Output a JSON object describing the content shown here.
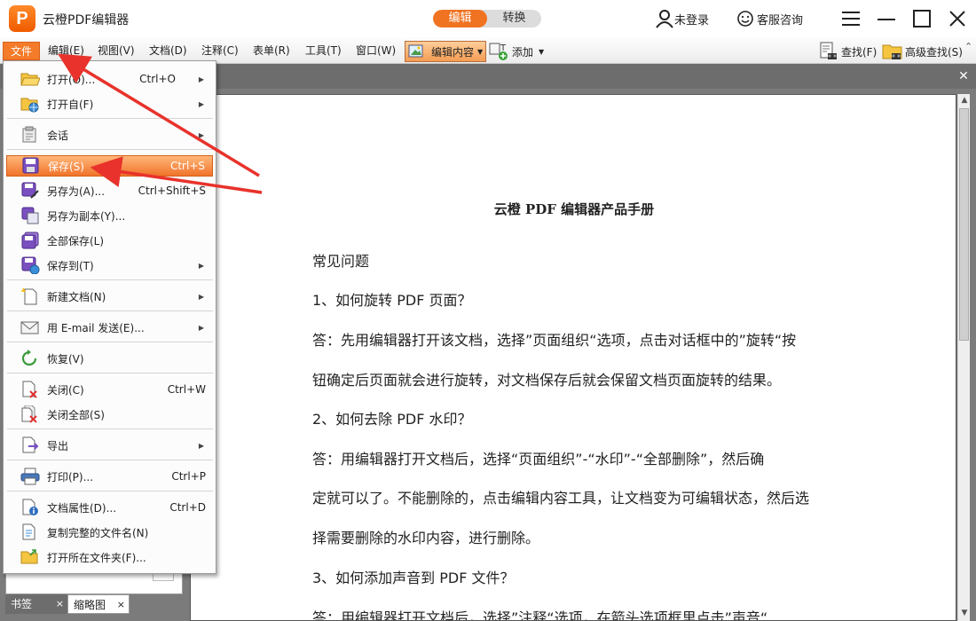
{
  "titlebar": {
    "logo_letter": "P",
    "app_title": "云橙PDF编辑器",
    "mode_edit": "编辑",
    "mode_convert": "转换",
    "login": "未登录",
    "support": "客服咨询"
  },
  "menubar": {
    "file": "文件",
    "edit": "编辑(E)",
    "view": "视图(V)",
    "document": "文档(D)",
    "comment": "注释(C)",
    "form": "表单(R)",
    "tools": "工具(T)",
    "window": "窗口(W)",
    "edit_content": "编辑内容",
    "add": "添加",
    "find": "查找(F)",
    "advanced_find": "高级查找(S)"
  },
  "file_menu": {
    "items": [
      {
        "label": "打开(O)...",
        "shortcut": "Ctrl+O"
      },
      {
        "label": "打开自(F)",
        "shortcut": ""
      },
      {
        "label": "会话",
        "shortcut": ""
      },
      {
        "label": "保存(S)",
        "shortcut": "Ctrl+S"
      },
      {
        "label": "另存为(A)...",
        "shortcut": "Ctrl+Shift+S"
      },
      {
        "label": "另存为副本(Y)...",
        "shortcut": ""
      },
      {
        "label": "全部保存(L)",
        "shortcut": ""
      },
      {
        "label": "保存到(T)",
        "shortcut": ""
      },
      {
        "label": "新建文档(N)",
        "shortcut": ""
      },
      {
        "label": "用 E-mail 发送(E)...",
        "shortcut": ""
      },
      {
        "label": "恢复(V)",
        "shortcut": ""
      },
      {
        "label": "关闭(C)",
        "shortcut": "Ctrl+W"
      },
      {
        "label": "关闭全部(S)",
        "shortcut": ""
      },
      {
        "label": "导出",
        "shortcut": ""
      },
      {
        "label": "打印(P)...",
        "shortcut": "Ctrl+P"
      },
      {
        "label": "文档属性(D)...",
        "shortcut": "Ctrl+D"
      },
      {
        "label": "复制完整的文件名(N)",
        "shortcut": ""
      },
      {
        "label": "打开所在文件夹(F)...",
        "shortcut": ""
      }
    ]
  },
  "left_panel": {
    "tab_bookmarks": "书签",
    "tab_thumbnails": "缩略图",
    "close_mark": "×"
  },
  "document": {
    "title": "云橙 PDF 编辑器产品手册",
    "lines": [
      "常见问题",
      "1、如何旋转 PDF 页面？",
      "答：先用编辑器打开该文档，选择”页面组织“选项，点击对话框中的”旋转“按",
      "钮确定后页面就会进行旋转，对文档保存后就会保留文档页面旋转的结果。",
      "2、如何去除 PDF 水印？",
      "答：用编辑器打开文档后，选择“页面组织”-“水印”-“全部删除”，然后确",
      "定就可以了。不能删除的，点击编辑内容工具，让文档变为可编辑状态，然后选",
      "择需要删除的水印内容，进行删除。",
      "3、如何添加声音到 PDF 文件？",
      "答：用编辑器打开文档后，选择”注释“选项，在箭头选项框里点击”声音“"
    ]
  },
  "colors": {
    "accent": "#f07322",
    "highlight": "#f0732a",
    "annotation_arrow": "#e8322b"
  }
}
